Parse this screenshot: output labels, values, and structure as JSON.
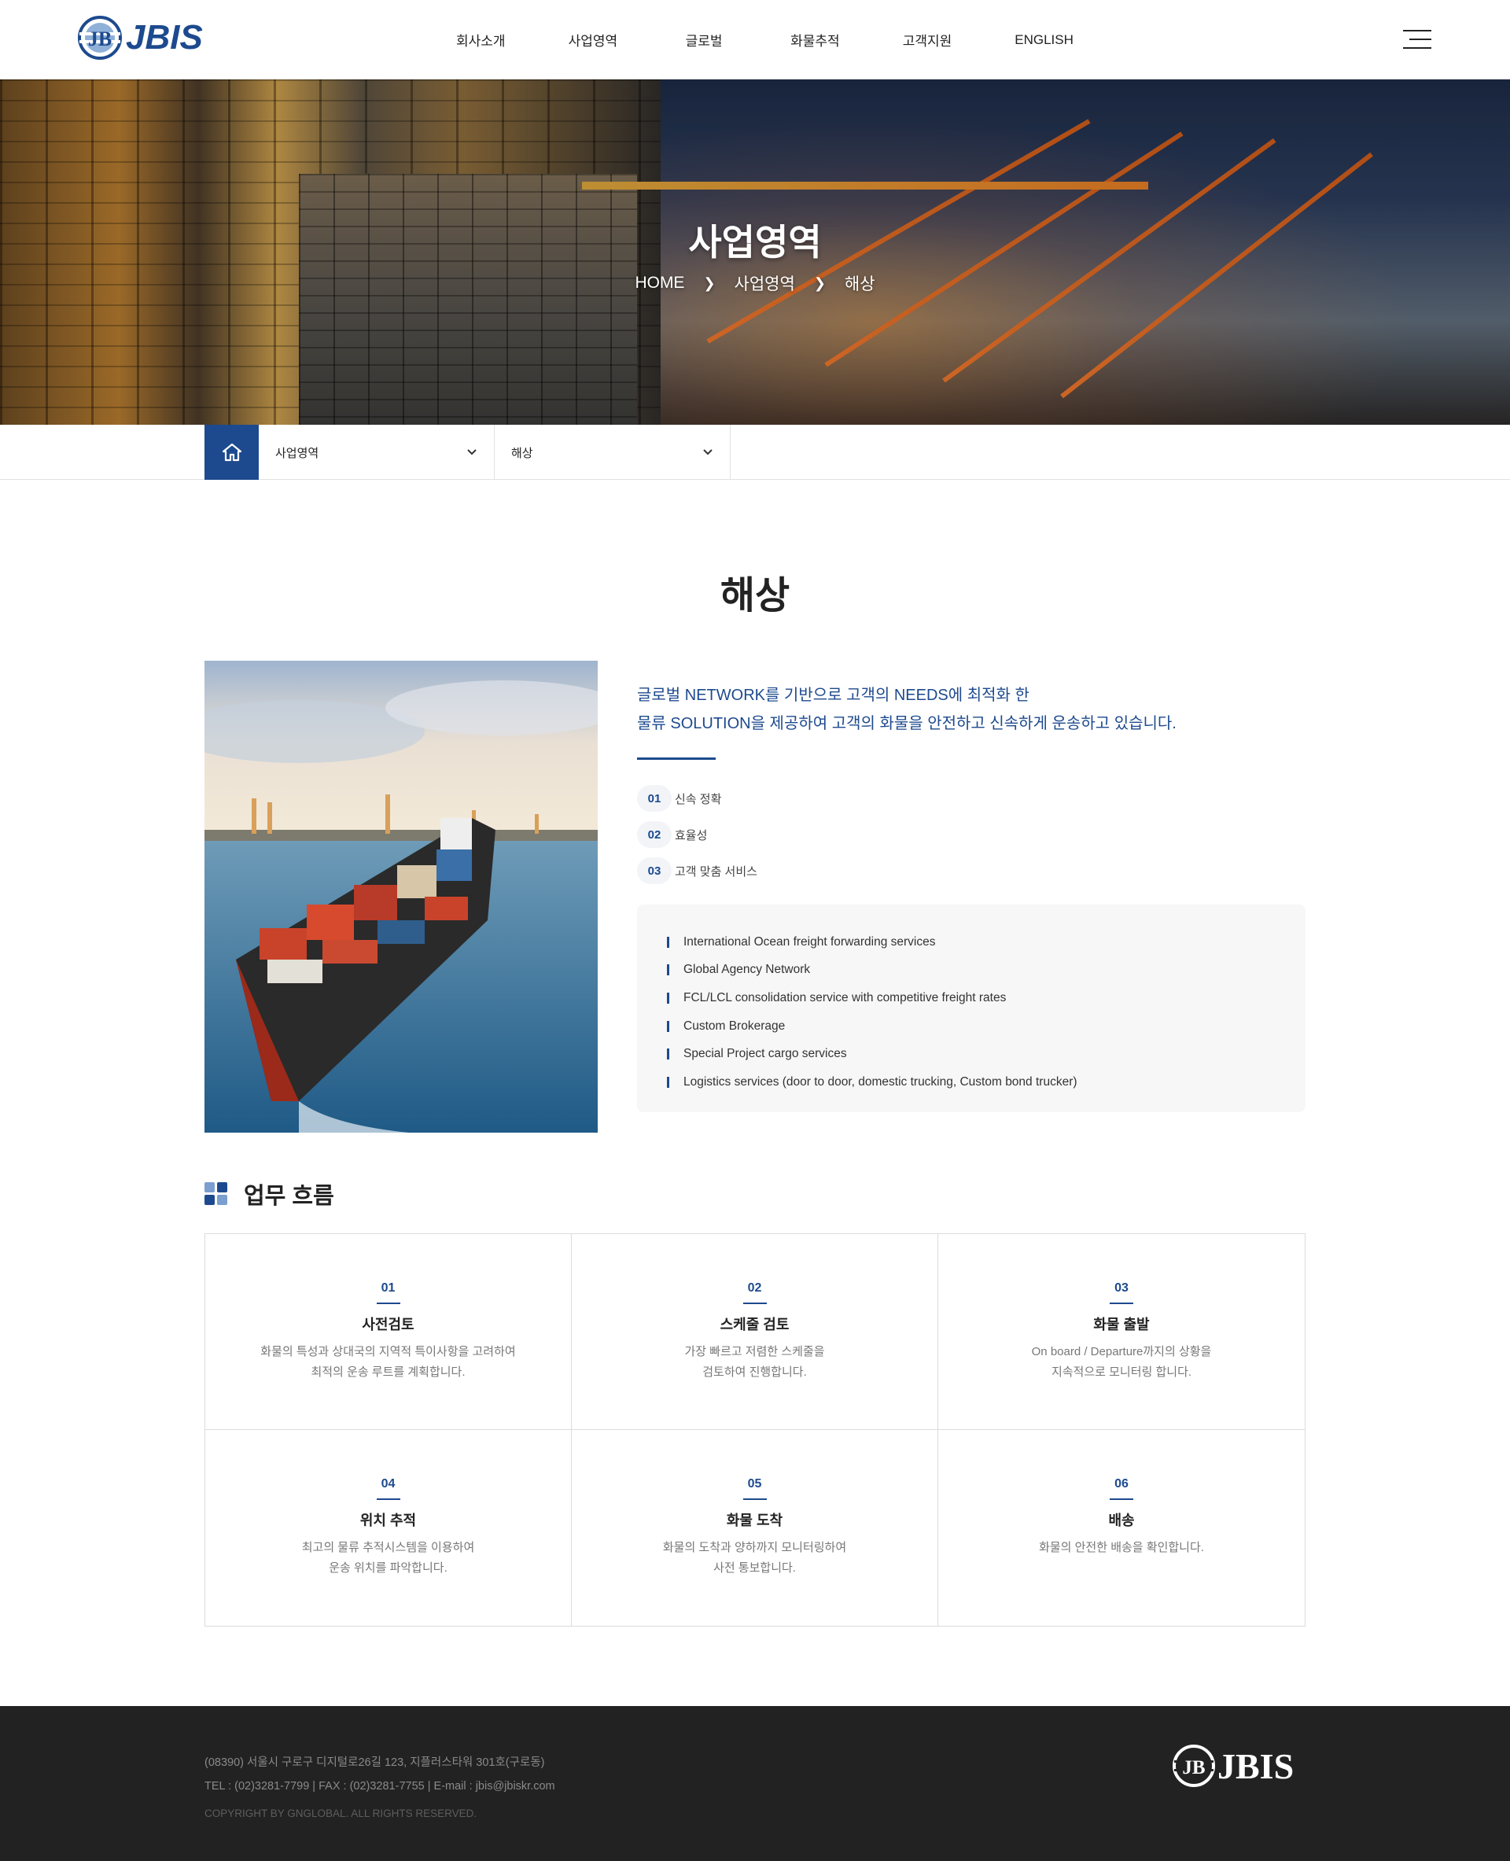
{
  "header": {
    "logo_text": "JBIS",
    "nav": [
      "회사소개",
      "사업영역",
      "글로벌",
      "화물추적",
      "고객지원",
      "ENGLISH"
    ]
  },
  "hero": {
    "title": "사업영역",
    "breadcrumb": [
      "HOME",
      "사업영역",
      "해상"
    ]
  },
  "subnav": {
    "select1": "사업영역",
    "select2": "해상"
  },
  "main": {
    "title": "해상",
    "intro_lines": [
      "글로벌 NETWORK를 기반으로 고객의 NEEDS에 최적화 한",
      "물류 SOLUTION을 제공하여 고객의 화물을 안전하고 신속하게 운송하고 있습니다."
    ],
    "features": [
      {
        "num": "01",
        "label": "신속 정확"
      },
      {
        "num": "02",
        "label": "효율성"
      },
      {
        "num": "03",
        "label": "고객 맞춤 서비스"
      }
    ],
    "services": [
      "International Ocean freight forwarding services",
      "Global Agency Network",
      "FCL/LCL consolidation service with competitive freight rates",
      "Custom Brokerage",
      "Special Project cargo services",
      "Logistics services (door to door, domestic trucking, Custom bond trucker)"
    ]
  },
  "process": {
    "title": "업무 흐름",
    "steps": [
      {
        "num": "01",
        "title": "사전검토",
        "desc": [
          "화물의 특성과 상대국의 지역적 특이사항을 고려하여",
          "최적의 운송 루트를 계획합니다."
        ]
      },
      {
        "num": "02",
        "title": "스케줄 검토",
        "desc": [
          "가장 빠르고 저렴한 스케줄을",
          "검토하여 진행합니다."
        ]
      },
      {
        "num": "03",
        "title": "화물 출발",
        "desc": [
          "On board / Departure까지의 상황을",
          "지속적으로 모니터링 합니다."
        ]
      },
      {
        "num": "04",
        "title": "위치 추적",
        "desc": [
          "최고의 물류 추적시스템을 이용하여",
          "운송 위치를 파악합니다."
        ]
      },
      {
        "num": "05",
        "title": "화물 도착",
        "desc": [
          "화물의 도착과 양하까지 모니터링하여",
          "사전 통보합니다."
        ]
      },
      {
        "num": "06",
        "title": "배송",
        "desc": [
          "화물의 안전한 배송을 확인합니다.",
          ""
        ]
      }
    ]
  },
  "footer": {
    "address": "(08390) 서울시 구로구 디지털로26길 123, 지플러스타워 301호(구로동)",
    "contact": "TEL : (02)3281-7799 | FAX : (02)3281-7755 | E-mail : jbis@jbiskr.com",
    "copyright": "COPYRIGHT BY GNGLOBAL. ALL RIGHTS RESERVED.",
    "logo_text": "JBIS"
  },
  "colors": {
    "brand": "#1d4a8e",
    "footer_bg": "#222222",
    "service_box": "#f7f7f7"
  },
  "icons": [
    "jb-emblem-icon",
    "hamburger-menu-icon",
    "home-icon",
    "chevron-down-icon",
    "chevron-right-icon",
    "grid-squares-icon"
  ]
}
